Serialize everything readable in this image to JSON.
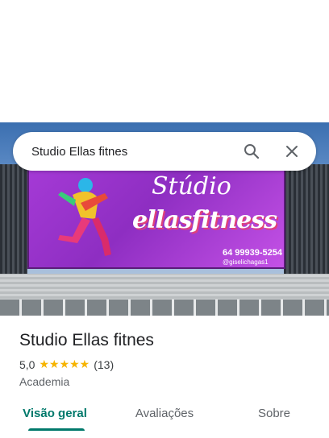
{
  "search": {
    "query": "Studio Ellas fitnes",
    "search_icon": "search-icon",
    "close_icon": "close-icon"
  },
  "photo": {
    "sign_line1": "Stúdio",
    "sign_line2": "ellasfitness",
    "sign_phone": "64 99939-5254",
    "sign_instagram": "@giselichagas1"
  },
  "place": {
    "name": "Studio Ellas fitnes",
    "rating": "5,0",
    "stars": "★★★★★",
    "review_count": "(13)",
    "category": "Academia"
  },
  "tabs": [
    {
      "label": "Visão geral",
      "active": true
    },
    {
      "label": "Avaliações",
      "active": false
    },
    {
      "label": "Sobre",
      "active": false
    }
  ],
  "colors": {
    "accent": "#00796b",
    "star": "#f6b400",
    "sign": "#a53ad6"
  }
}
